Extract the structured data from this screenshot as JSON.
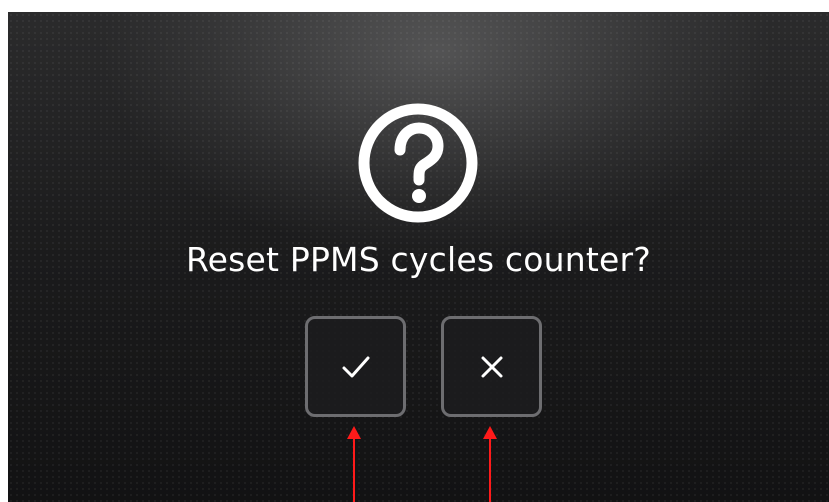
{
  "dialog": {
    "icon": "question-circle-icon",
    "title": "Reset PPMS cycles counter?",
    "confirm_button": {
      "icon": "checkmark-icon"
    },
    "cancel_button": {
      "icon": "close-icon"
    }
  },
  "annotations": {
    "arrow_color": "#ff1a1a",
    "arrows": [
      "arrow-to-confirm",
      "arrow-to-cancel"
    ]
  },
  "colors": {
    "background": "#1c1c1d",
    "text": "#ffffff",
    "button_border": "#6d6d70"
  }
}
